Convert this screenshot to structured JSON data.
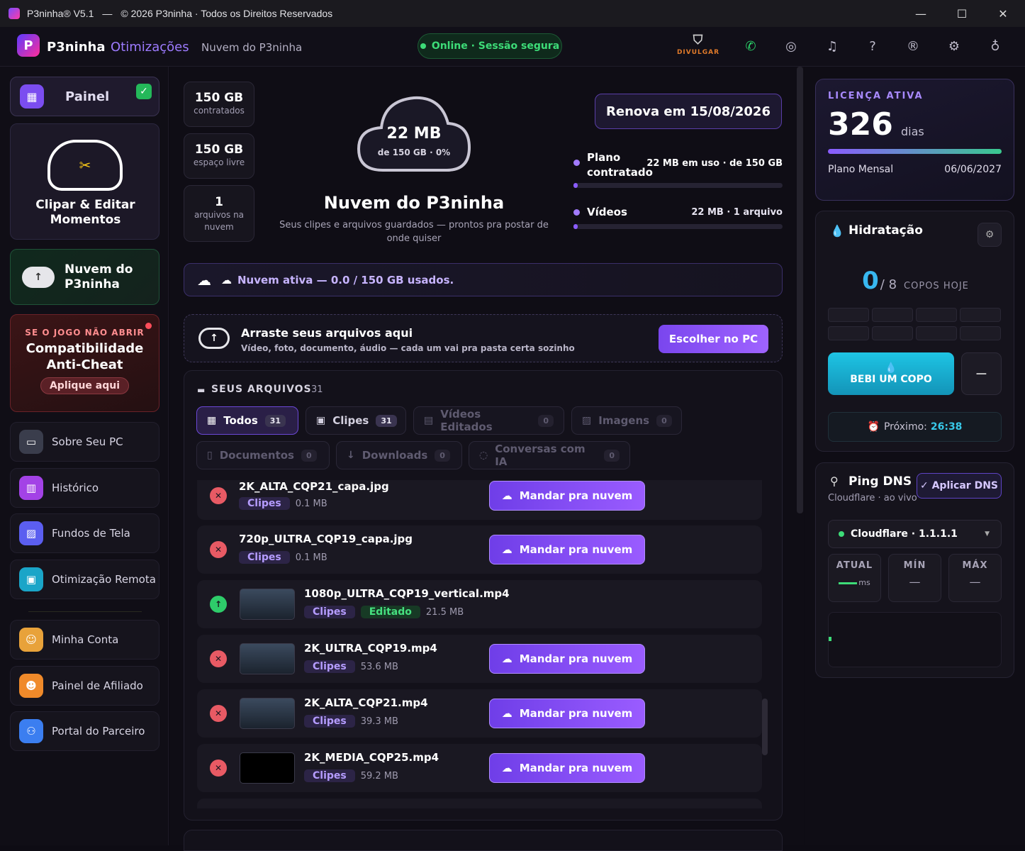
{
  "window": {
    "app": "P3ninha® V5.1",
    "dash": "—",
    "copyright": "© 2026 P3ninha · Todos os Direitos Reservados",
    "min": "—",
    "max": "☐",
    "close": "✕"
  },
  "topbar": {
    "brand": "P3ninha",
    "brand_suffix": "Otimizações",
    "breadcrumb": "Nuvem do P3ninha",
    "status": "Online · Sessão segura",
    "divulgar": "DIVULGAR"
  },
  "sidebar": {
    "painel": "Painel",
    "clipar": "Clipar & Editar Momentos",
    "nuvem": "Nuvem do P3ninha",
    "anticheat": {
      "kicker": "SE O JOGO NÃO ABRIR",
      "title": "Compatibilidade Anti-Cheat",
      "cta": "Aplique aqui"
    },
    "items": [
      {
        "label": "Sobre Seu PC",
        "icon": "monitor-icon",
        "color": "#3a3d4c"
      },
      {
        "label": "Histórico",
        "icon": "chart-icon",
        "color": "#a342e6"
      },
      {
        "label": "Fundos de Tela",
        "icon": "image-icon",
        "color": "#5b5ef0"
      },
      {
        "label": "Otimização Remota",
        "icon": "remote-icon",
        "color": "#1aa5c8"
      },
      {
        "label": "Minha Conta",
        "icon": "user-icon",
        "color": "#e8a23a"
      },
      {
        "label": "Painel de Afiliado",
        "icon": "users-icon",
        "color": "#f08a2a"
      },
      {
        "label": "Portal do Parceiro",
        "icon": "partner-icon",
        "color": "#3b7ef0"
      }
    ]
  },
  "stats": [
    {
      "value": "150 GB",
      "label": "contratados"
    },
    {
      "value": "150 GB",
      "label": "espaço livre"
    },
    {
      "value": "1",
      "label": "arquivos na nuvem"
    }
  ],
  "cloud": {
    "used": "22 MB",
    "of": "de 150 GB · 0%",
    "title": "Nuvem do P3ninha",
    "subtitle": "Seus clipes e arquivos guardados — prontos pra postar de onde quiser"
  },
  "renova": "Renova em 15/08/2026",
  "usage": [
    {
      "label": "Plano contratado",
      "value": "22 MB em uso · de 150 GB",
      "fraction": 0.0001
    },
    {
      "label": "Vídeos",
      "value": "22 MB · 1 arquivo",
      "fraction": 0.0001
    }
  ],
  "status_bar": "Nuvem ativa — 0.0 / 150 GB usados.",
  "drop": {
    "title": "Arraste seus arquivos aqui",
    "subtitle": "Vídeo, foto, documento, áudio — cada um vai pra pasta certa sozinho",
    "button": "Escolher no PC"
  },
  "files": {
    "heading": "SEUS ARQUIVOS",
    "count": "31",
    "tabs": [
      {
        "label": "Todos",
        "count": "31",
        "state": "act"
      },
      {
        "label": "Clipes",
        "count": "31",
        "state": "on"
      },
      {
        "label": "Vídeos Editados",
        "count": "0",
        "state": ""
      },
      {
        "label": "Imagens",
        "count": "0",
        "state": ""
      },
      {
        "label": "Documentos",
        "count": "0",
        "state": ""
      },
      {
        "label": "Downloads",
        "count": "0",
        "state": ""
      },
      {
        "label": "Conversas com IA",
        "count": "0",
        "state": ""
      }
    ],
    "send_label": "Mandar pra nuvem",
    "rows": [
      {
        "name": "2K_ALTA_CQP21_capa.jpg",
        "tag": "Clipes",
        "size": "0.1 MB",
        "thumb": false,
        "uploaded": false
      },
      {
        "name": "720p_ULTRA_CQP19_capa.jpg",
        "tag": "Clipes",
        "size": "0.1 MB",
        "thumb": false,
        "uploaded": false
      },
      {
        "name": "1080p_ULTRA_CQP19_vertical.mp4",
        "tag": "Clipes",
        "tag2": "Editado",
        "size": "21.5 MB",
        "thumb": true,
        "uploaded": true
      },
      {
        "name": "2K_ULTRA_CQP19.mp4",
        "tag": "Clipes",
        "size": "53.6 MB",
        "thumb": true,
        "uploaded": false
      },
      {
        "name": "2K_ALTA_CQP21.mp4",
        "tag": "Clipes",
        "size": "39.3 MB",
        "thumb": true,
        "uploaded": false
      },
      {
        "name": "2K_MEDIA_CQP25.mp4",
        "tag": "Clipes",
        "size": "59.2 MB",
        "thumb": true,
        "black": true,
        "uploaded": false
      }
    ]
  },
  "license": {
    "kicker": "LICENÇA ATIVA",
    "days": "326",
    "days_label": "dias",
    "plan": "Plano Mensal",
    "date": "06/06/2027",
    "fraction": 1
  },
  "hydration": {
    "title": "Hidratação",
    "count": "0",
    "total": "/ 8",
    "label": "COPOS HOJE",
    "button": "BEBI UM COPO",
    "minus": "−",
    "next_label": "Próximo:",
    "next_time": "26:38"
  },
  "ping": {
    "title": "Ping DNS",
    "subtitle": "Cloudflare · ao vivo",
    "apply": "✓ Aplicar DNS",
    "selected": "Cloudflare · 1.1.1.1",
    "atual": "ATUAL",
    "min": "MÍN",
    "max": "MÁX",
    "ms": "ms",
    "dash": "—"
  }
}
